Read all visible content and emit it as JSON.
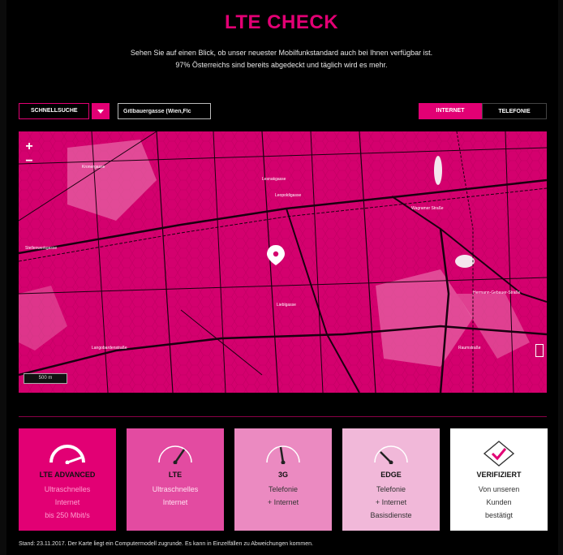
{
  "header": {
    "title": "LTE CHECK",
    "subtitle_line1": "Sehen Sie auf einen Blick, ob unser neuester Mobilfunkstandard auch bei Ihnen verfügbar ist.",
    "subtitle_line2": "97% Österreichs sind bereits abgedeckt und täglich wird es mehr."
  },
  "controls": {
    "quick_search_label": "SCHNELLSUCHE",
    "address_value": "Gitlbauergasse (Wien,Flc",
    "tabs": [
      {
        "label": "INTERNET",
        "active": true
      },
      {
        "label": "TELEFONIE",
        "active": false
      }
    ]
  },
  "map": {
    "zoom_in": "+",
    "zoom_out": "−",
    "scale_label": "500 m",
    "colors": {
      "base": "#d4006e",
      "road": "#1a0010",
      "light_area": "#e86aa8"
    },
    "street_labels": [
      "Kronergasse",
      "Lesnakgasse",
      "Leopoldigasse",
      "Wagramer Straße",
      "Lieblgasse",
      "Stellenwerkgasse",
      "Langobardenstraße",
      "Hermann-Gebauer-Straße",
      "Raumstraße"
    ]
  },
  "legend": [
    {
      "title": "LTE ADVANCED",
      "lines": [
        "Ultraschnelles",
        "Internet",
        "bis 250 Mbit/s"
      ],
      "bg": "#e20074"
    },
    {
      "title": "LTE",
      "lines": [
        "Ultraschnelles",
        "Internet",
        ""
      ],
      "bg": "#e34ba1"
    },
    {
      "title": "3G",
      "lines": [
        "Telefonie",
        "+ Internet",
        ""
      ],
      "bg": "#eb8ac1"
    },
    {
      "title": "EDGE",
      "lines": [
        "Telefonie",
        "+ Internet",
        "Basisdienste"
      ],
      "bg": "#f1b8d9"
    },
    {
      "title": "VERIFIZIERT",
      "lines": [
        "Von unseren",
        "Kunden",
        "bestätigt"
      ],
      "bg": "#ffffff"
    }
  ],
  "footer": {
    "text": "Stand: 23.11.2017. Der Karte liegt ein Computermodell zugrunde. Es kann in Einzelfällen zu Abweichungen kommen."
  },
  "accent": "#e20074"
}
